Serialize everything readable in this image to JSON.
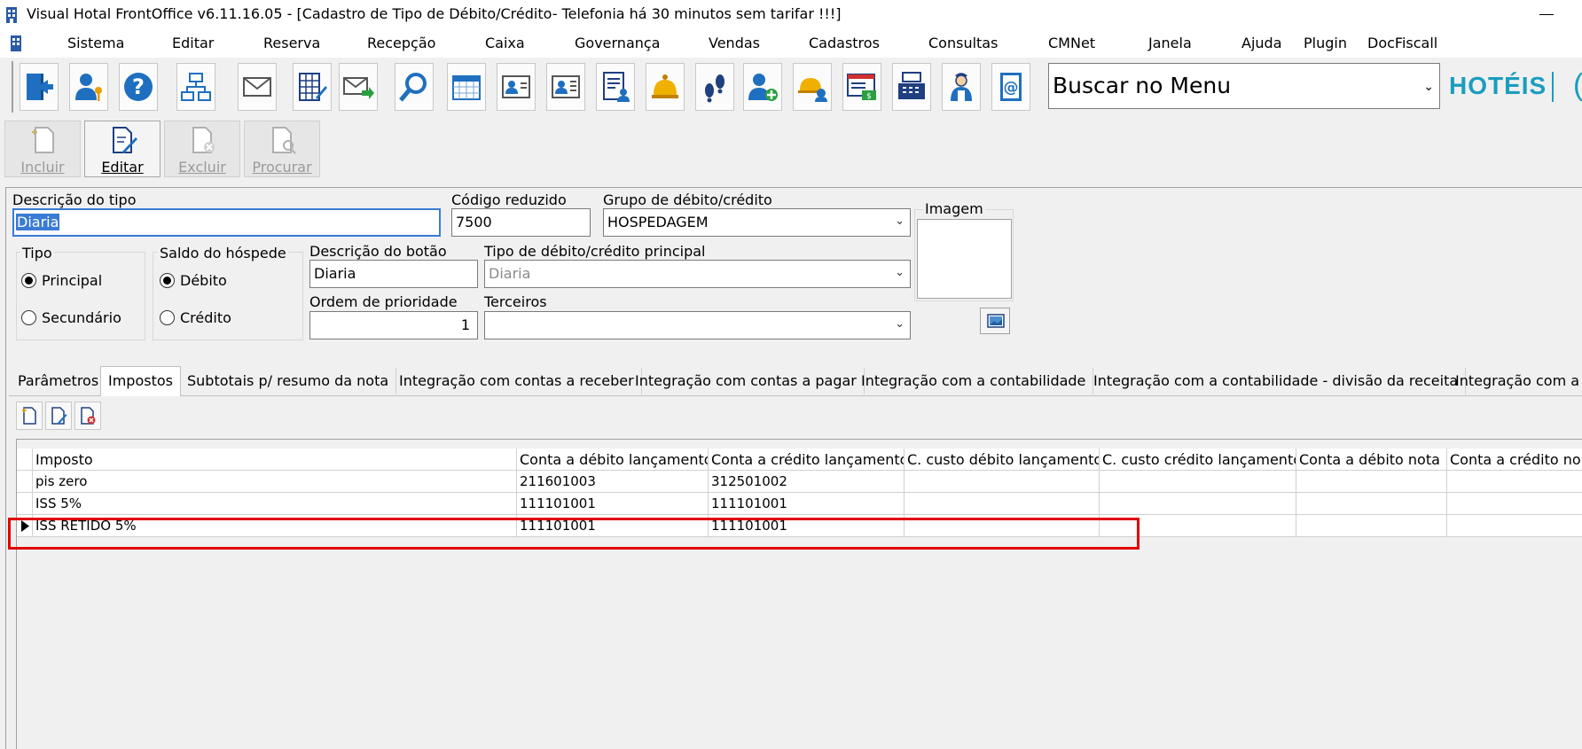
{
  "window": {
    "title": "Visual Hotal FrontOffice v6.11.16.05 - [Cadastro de Tipo de Débito/Crédito- Telefonia há 30 minutos sem tarifar !!!]"
  },
  "menu": [
    "Sistema",
    "Editar",
    "Reserva",
    "Recepção",
    "Caixa",
    "Governança",
    "Vendas",
    "Cadastros",
    "Consultas",
    "CMNet",
    "Janela",
    "Ajuda",
    "Plugin",
    "DocFiscall"
  ],
  "toolbar": {
    "icons": [
      "exit-icon",
      "user-key-icon",
      "help-icon",
      "org-chart-icon",
      "envelope-icon",
      "spreadsheet-edit-icon",
      "mail-forward-icon",
      "search-icon",
      "calendar-icon",
      "guest-card-icon",
      "guest-card-2-icon",
      "guest-list-icon",
      "bell-icon",
      "footprints-icon",
      "add-user-icon",
      "concierge-icon",
      "invoice-icon",
      "cash-register-icon",
      "maid-icon",
      "address-book-icon"
    ],
    "search_menu_value": "Buscar no Menu",
    "brand": "HOTÉIS",
    "brand_tail": "("
  },
  "actions": [
    {
      "label": "Incluir",
      "enabled": false
    },
    {
      "label": "Editar",
      "enabled": true
    },
    {
      "label": "Excluir",
      "enabled": false
    },
    {
      "label": "Procurar",
      "enabled": false
    }
  ],
  "form": {
    "descricao_tipo": {
      "label": "Descrição do tipo",
      "value": "Diaria"
    },
    "codigo_reduzido": {
      "label": "Código reduzido",
      "value": "7500"
    },
    "grupo": {
      "label": "Grupo de débito/crédito",
      "value": "HOSPEDAGEM"
    },
    "imagem_label": "Imagem",
    "tipo": {
      "label": "Tipo",
      "options": [
        "Principal",
        "Secundário"
      ],
      "selected": "Principal"
    },
    "saldo": {
      "label": "Saldo do hóspede",
      "options": [
        "Débito",
        "Crédito"
      ],
      "selected": "Débito"
    },
    "descricao_botao": {
      "label": "Descrição do botão",
      "value": "Diaria"
    },
    "tipo_principal": {
      "label": "Tipo de débito/crédito principal",
      "value": "Diaria"
    },
    "ordem": {
      "label": "Ordem de prioridade",
      "value": "1"
    },
    "terceiros": {
      "label": "Terceiros",
      "value": ""
    }
  },
  "tabs": [
    {
      "label": "Parâmetros",
      "active": false
    },
    {
      "label": "Impostos",
      "active": true
    },
    {
      "label": "Subtotais p/ resumo da nota",
      "active": false
    },
    {
      "label": "Integração com contas a receber",
      "active": false
    },
    {
      "label": "Integração com contas a pagar",
      "active": false
    },
    {
      "label": "Integração com a contabilidade",
      "active": false
    },
    {
      "label": "Integração com a contabilidade - divisão da receita",
      "active": false
    },
    {
      "label": "Integração com a c",
      "active": false
    }
  ],
  "grid": {
    "columns": [
      "Imposto",
      "Conta a débito lançamento",
      "Conta a crédito lançamento",
      "C. custo débito lançamento",
      "C. custo crédito lançamento",
      "Conta a débito nota",
      "Conta a crédito no"
    ],
    "rows": [
      [
        "pis zero",
        "211601003",
        "312501002",
        "",
        "",
        "",
        ""
      ],
      [
        "ISS 5%",
        "111101001",
        "111101001",
        "",
        "",
        "",
        ""
      ],
      [
        "ISS RETIDO 5%",
        "111101001",
        "111101001",
        "",
        "",
        "",
        ""
      ]
    ],
    "current_row": 2
  }
}
